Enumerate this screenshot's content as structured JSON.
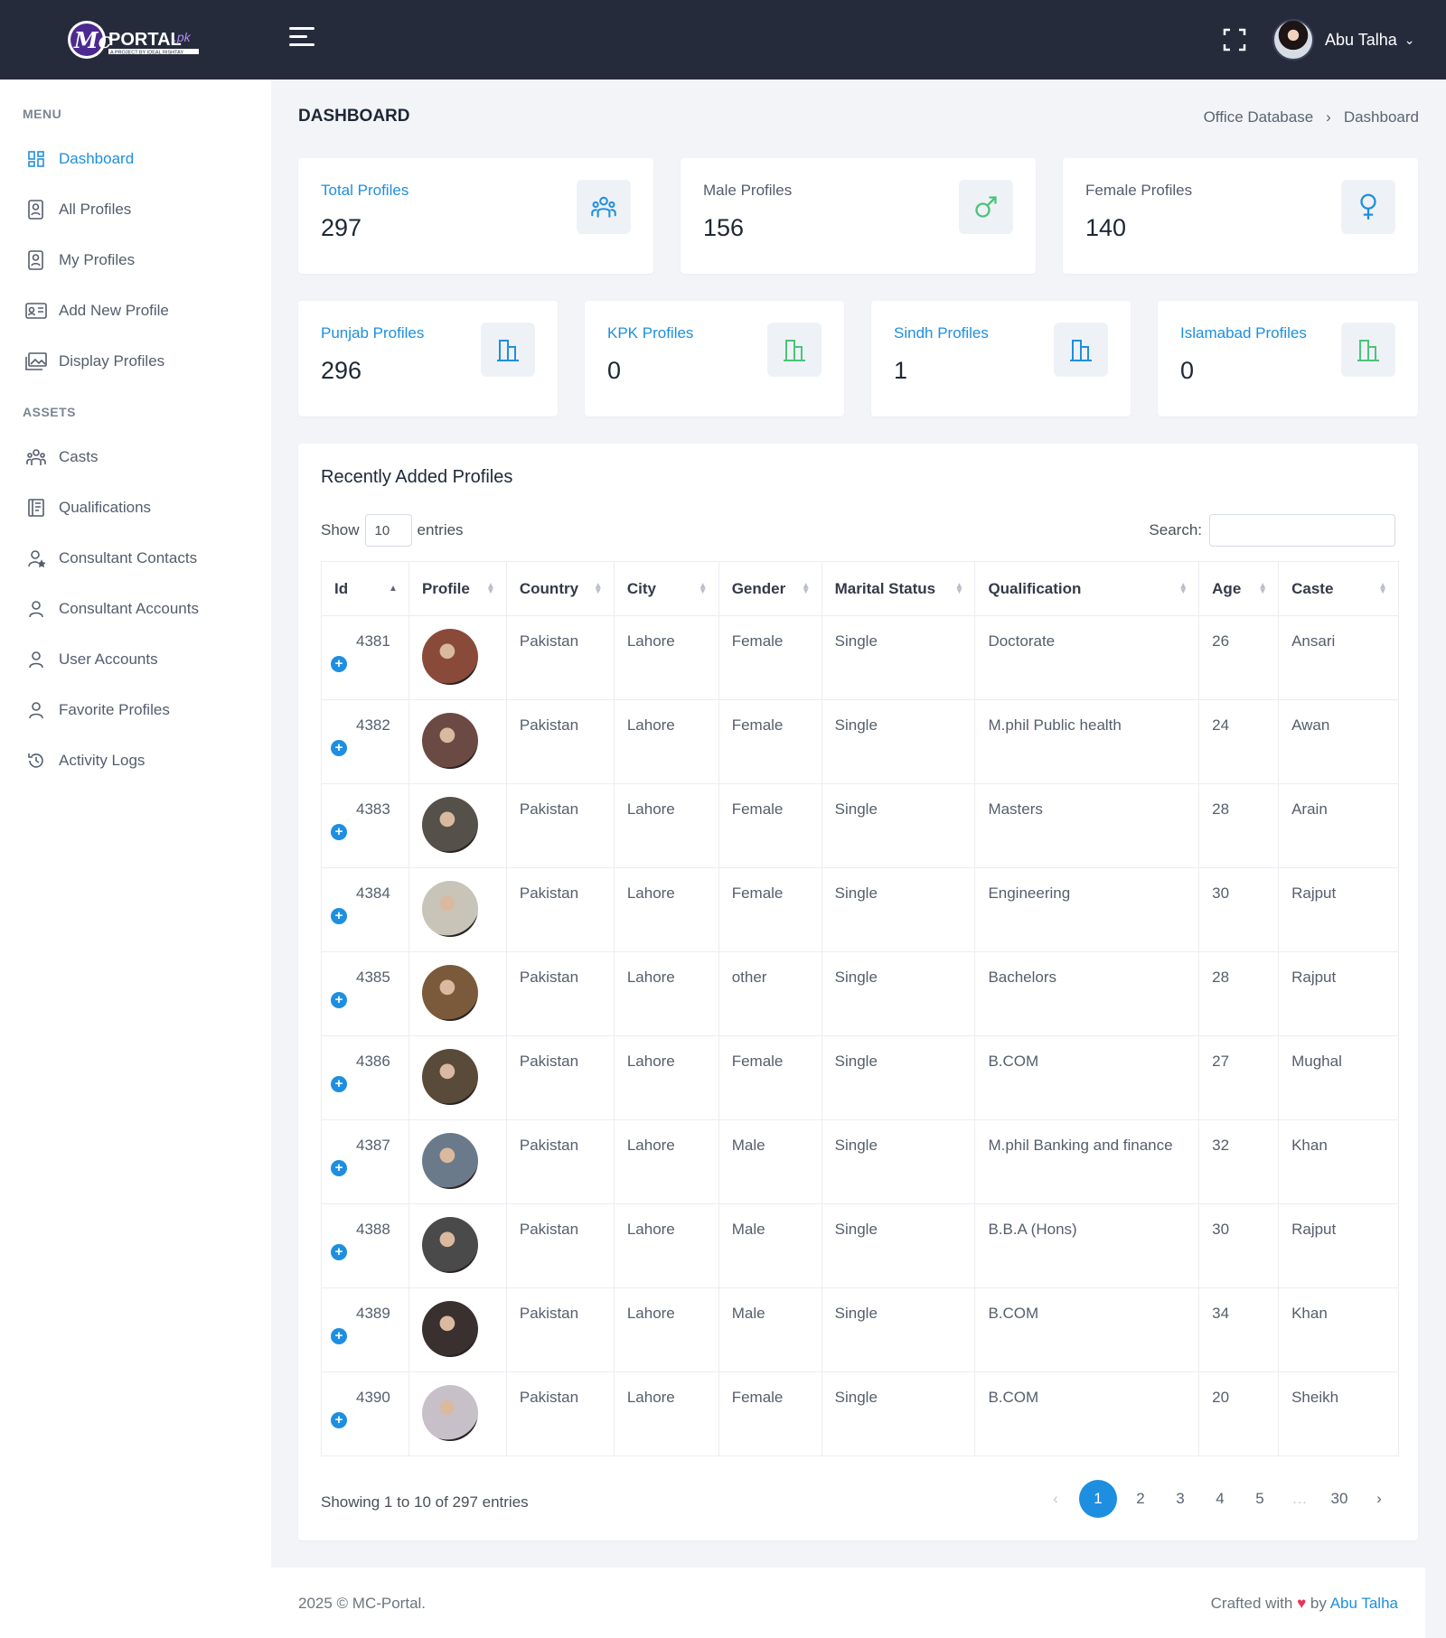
{
  "header": {
    "logo_text": "Mc PORTAL.pk",
    "logo_tagline": "A PROJECT BY IDEAL RISHTAY",
    "user_name": "Abu Talha"
  },
  "sidebar": {
    "menu_heading": "MENU",
    "assets_heading": "ASSETS",
    "menu_items": [
      {
        "label": "Dashboard",
        "icon": "grid-icon",
        "active": true
      },
      {
        "label": "All Profiles",
        "icon": "profile-card-icon"
      },
      {
        "label": "My Profiles",
        "icon": "profile-card-icon"
      },
      {
        "label": "Add New Profile",
        "icon": "id-card-icon"
      },
      {
        "label": "Display Profiles",
        "icon": "gallery-icon"
      }
    ],
    "asset_items": [
      {
        "label": "Casts",
        "icon": "group-icon"
      },
      {
        "label": "Qualifications",
        "icon": "book-icon"
      },
      {
        "label": "Consultant Contacts",
        "icon": "user-star-icon"
      },
      {
        "label": "Consultant Accounts",
        "icon": "user-icon"
      },
      {
        "label": "User Accounts",
        "icon": "user-icon"
      },
      {
        "label": "Favorite Profiles",
        "icon": "user-icon"
      },
      {
        "label": "Activity Logs",
        "icon": "history-icon"
      }
    ]
  },
  "page": {
    "title": "DASHBOARD",
    "breadcrumb": [
      "Office Database",
      "Dashboard"
    ]
  },
  "stats_row1": [
    {
      "label": "Total Profiles",
      "value": "297",
      "icon": "group-icon",
      "label_color": "#1e8fe0"
    },
    {
      "label": "Male Profiles",
      "value": "156",
      "icon": "male-icon",
      "label_color": "#545d6d"
    },
    {
      "label": "Female Profiles",
      "value": "140",
      "icon": "female-icon",
      "label_color": "#545d6d"
    }
  ],
  "stats_row2": [
    {
      "label": "Punjab Profiles",
      "value": "296",
      "icon": "building-icon",
      "icon_color": "#1e8fe0"
    },
    {
      "label": "KPK Profiles",
      "value": "0",
      "icon": "building-icon",
      "icon_color": "#4cc37a"
    },
    {
      "label": "Sindh Profiles",
      "value": "1",
      "icon": "building-icon",
      "icon_color": "#1e8fe0"
    },
    {
      "label": "Islamabad Profiles",
      "value": "0",
      "icon": "building-icon",
      "icon_color": "#4cc37a"
    }
  ],
  "table": {
    "title": "Recently Added Profiles",
    "show_label": "Show",
    "entries_label": "entries",
    "page_length": "10",
    "search_label": "Search:",
    "columns": [
      "Id",
      "Profile",
      "Country",
      "City",
      "Gender",
      "Marital Status",
      "Qualification",
      "Age",
      "Caste"
    ],
    "rows": [
      {
        "id": "4381",
        "country": "Pakistan",
        "city": "Lahore",
        "gender": "Female",
        "marital": "Single",
        "qualification": "Doctorate",
        "age": "26",
        "caste": "Ansari"
      },
      {
        "id": "4382",
        "country": "Pakistan",
        "city": "Lahore",
        "gender": "Female",
        "marital": "Single",
        "qualification": "M.phil Public health",
        "age": "24",
        "caste": "Awan"
      },
      {
        "id": "4383",
        "country": "Pakistan",
        "city": "Lahore",
        "gender": "Female",
        "marital": "Single",
        "qualification": "Masters",
        "age": "28",
        "caste": "Arain"
      },
      {
        "id": "4384",
        "country": "Pakistan",
        "city": "Lahore",
        "gender": "Female",
        "marital": "Single",
        "qualification": "Engineering",
        "age": "30",
        "caste": "Rajput"
      },
      {
        "id": "4385",
        "country": "Pakistan",
        "city": "Lahore",
        "gender": "other",
        "marital": "Single",
        "qualification": "Bachelors",
        "age": "28",
        "caste": "Rajput"
      },
      {
        "id": "4386",
        "country": "Pakistan",
        "city": "Lahore",
        "gender": "Female",
        "marital": "Single",
        "qualification": "B.COM",
        "age": "27",
        "caste": "Mughal"
      },
      {
        "id": "4387",
        "country": "Pakistan",
        "city": "Lahore",
        "gender": "Male",
        "marital": "Single",
        "qualification": "M.phil Banking and finance",
        "age": "32",
        "caste": "Khan"
      },
      {
        "id": "4388",
        "country": "Pakistan",
        "city": "Lahore",
        "gender": "Male",
        "marital": "Single",
        "qualification": "B.B.A (Hons)",
        "age": "30",
        "caste": "Rajput"
      },
      {
        "id": "4389",
        "country": "Pakistan",
        "city": "Lahore",
        "gender": "Male",
        "marital": "Single",
        "qualification": "B.COM",
        "age": "34",
        "caste": "Khan"
      },
      {
        "id": "4390",
        "country": "Pakistan",
        "city": "Lahore",
        "gender": "Female",
        "marital": "Single",
        "qualification": "B.COM",
        "age": "20",
        "caste": "Sheikh"
      }
    ],
    "info": "Showing 1 to 10 of 297 entries",
    "pages": [
      "1",
      "2",
      "3",
      "4",
      "5",
      "…",
      "30"
    ],
    "prev": "‹",
    "next": "›"
  },
  "footer": {
    "left": "2025 © MC-Portal.",
    "crafted": "Crafted with",
    "by": "by",
    "author": "Abu Talha"
  },
  "colors": {
    "accent": "#1e8fe0",
    "topbar": "#262b3c",
    "green": "#4cc37a"
  }
}
